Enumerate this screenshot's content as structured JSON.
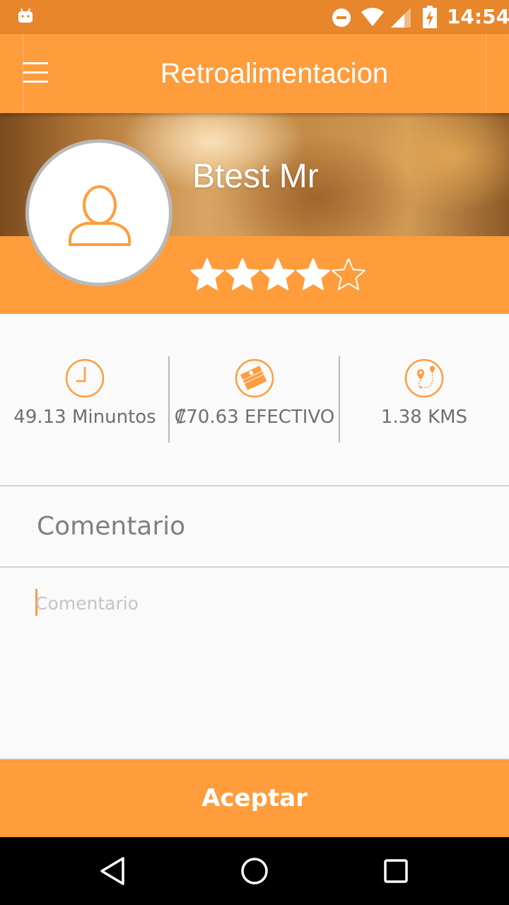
{
  "status_bar": {
    "time": "14:54"
  },
  "app_bar": {
    "title": "Retroalimentacion"
  },
  "profile": {
    "name": "Btest Mr",
    "rating": 4,
    "rating_max": 5
  },
  "stats": [
    {
      "icon": "clock-icon",
      "text": "49.13 Minuntos"
    },
    {
      "icon": "cash-icon",
      "text": "₡70.63 EFECTIVO"
    },
    {
      "icon": "route-map-icon",
      "text": "1.38 KMS"
    }
  ],
  "comment": {
    "label": "Comentario",
    "placeholder": "Comentario",
    "value": ""
  },
  "accept_button": {
    "label": "Aceptar"
  },
  "colors": {
    "accent": "#ff9c3c",
    "status_bar": "#e7862a",
    "avatar_border": "#b9b9b9",
    "text_gray": "#6f6f6f"
  }
}
